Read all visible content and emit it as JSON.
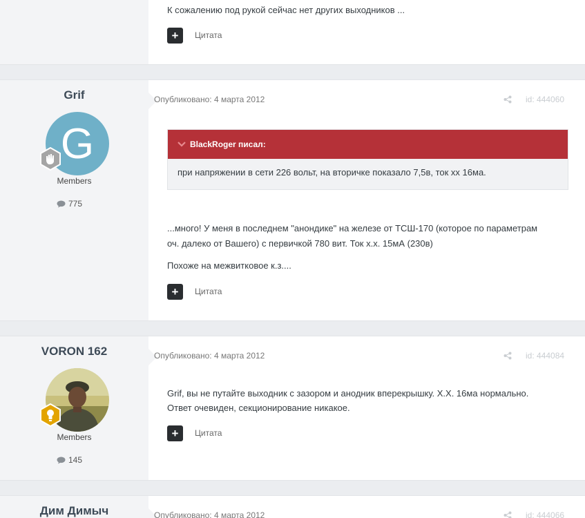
{
  "posts": [
    {
      "author": "",
      "group": "",
      "post_count": "",
      "date": "",
      "id": "",
      "text": [
        "К сожалению под рукой сейчас нет других выходников ..."
      ],
      "cite_label": "Цитата"
    },
    {
      "author": "Grif",
      "avatar_letter": "G",
      "avatar_color": "#6fb0c8",
      "group": "Members",
      "post_count": "775",
      "date": "Опубликовано: 4 марта 2012",
      "id": "id: 444060",
      "quote": {
        "author": "BlackRoger писал:",
        "text": "при напряжении в сети 226 вольт, на вторичке показало 7,5в, ток хх 16ма."
      },
      "text": [
        "...много! У меня в последнем \"анондике\" на железе от ТСШ-170 (которое по параметрам",
        "оч. далеко от Вашего) с первичкой 780 вит. Ток х.х. 15мА (230в)",
        "Похоже на межвитковое к.з...."
      ],
      "cite_label": "Цитата"
    },
    {
      "author": "VORON 162",
      "group": "Members",
      "post_count": "145",
      "date": "Опубликовано: 4 марта 2012",
      "id": "id: 444084",
      "text": [
        "Grif, вы не путайте выходник с зазором и анодник вперекрышку. Х.Х. 16ма нормально.",
        "Ответ очевиден, секционирование никакое."
      ],
      "cite_label": "Цитата"
    },
    {
      "author": "Дим Димыч",
      "date": "Опубликовано: 4 марта 2012",
      "id": "id: 444066"
    }
  ],
  "colors": {
    "quote_header": "#b53138",
    "page_bg": "#ebedf0",
    "author_panel": "#f3f4f6"
  }
}
